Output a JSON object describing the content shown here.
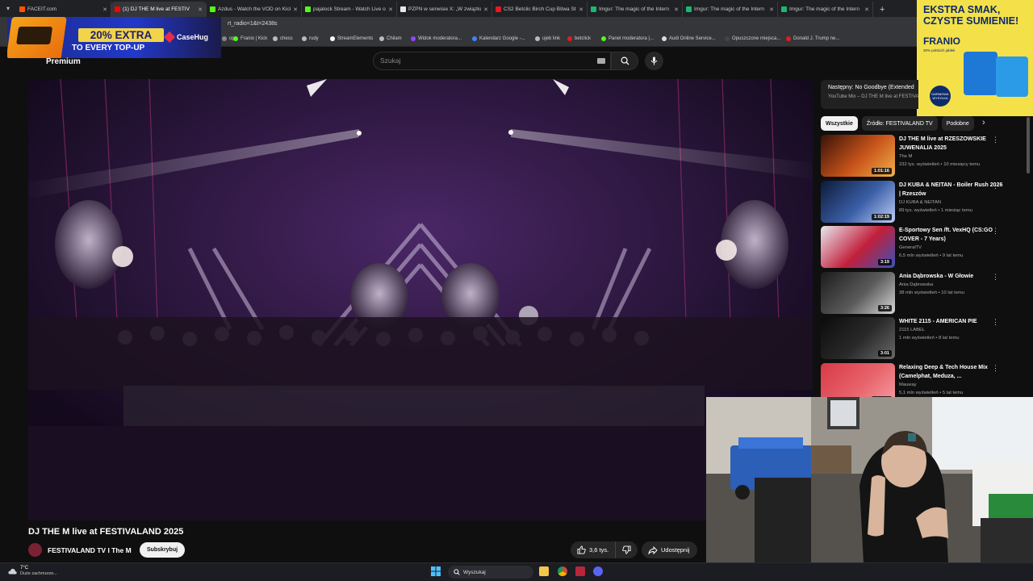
{
  "browser": {
    "tabs": [
      {
        "title": "FACEIT.com",
        "color": "#ff5500",
        "active": false
      },
      {
        "title": "(1) DJ THE M live at FESTIV",
        "color": "#ff0000",
        "active": true
      },
      {
        "title": "Azdus - Watch the VOD on Kick",
        "color": "#53fc18",
        "active": false
      },
      {
        "title": "pajalock Stream - Watch Live o",
        "color": "#53fc18",
        "active": false
      },
      {
        "title": "PZPN w serwisie X: „W związku",
        "color": "#e7e7e7",
        "active": false
      },
      {
        "title": "CS2 Betclic Birch Cup Bitwa Str",
        "color": "#e31b23",
        "active": false
      },
      {
        "title": "Imgur: The magic of the Intern",
        "color": "#1bb76e",
        "active": false
      },
      {
        "title": "Imgur: The magic of the Intern",
        "color": "#1bb76e",
        "active": false
      },
      {
        "title": "Imgur: The magic of the Intern",
        "color": "#1bb76e",
        "active": false
      }
    ],
    "url_fragment": "rt_radio=1&t=2438s",
    "bookmarks": [
      {
        "label": "op",
        "color": "#888888"
      },
      {
        "label": "Franio | Kick",
        "color": "#53fc18"
      },
      {
        "label": "chess",
        "color": "#bbbbbb"
      },
      {
        "label": "rudy",
        "color": "#bbbbbb"
      },
      {
        "label": "StreamElements",
        "color": "#ffffff"
      },
      {
        "label": "Chilam",
        "color": "#bbbbbb"
      },
      {
        "label": "Widok moderatora...",
        "color": "#9146ff"
      },
      {
        "label": "Kalendarz Google -...",
        "color": "#4285f4"
      },
      {
        "label": "ujeb link",
        "color": "#bbbbbb"
      },
      {
        "label": "betclick",
        "color": "#e31b23"
      },
      {
        "label": "Panel moderatora |...",
        "color": "#53fc18"
      },
      {
        "label": "Audi Online Service...",
        "color": "#dddddd"
      },
      {
        "label": "Opuszczone miejsca...",
        "color": "#444444"
      },
      {
        "label": "Donald J. Trump ne...",
        "color": "#e31b23"
      }
    ]
  },
  "ads": {
    "left": {
      "percent": "20% EXTRA",
      "sub": "TO EVERY TOP-UP",
      "brand": "CaseHug"
    },
    "right": {
      "headline1": "EKSTRA SMAK,",
      "headline2": "CZYSTE SUMIENIE!",
      "name": "FRANIO",
      "small": "30% polskich jabłek",
      "badge": "DARMOWA WYSYŁKA"
    }
  },
  "youtube": {
    "logo": "Premium",
    "search_placeholder": "Szukaj",
    "video_title": "DJ THE M live at FESTIVALAND 2025",
    "channel": "FESTIVALAND TV I The M",
    "subscribe": "Subskrybuj",
    "likes": "3,6 tys.",
    "share": "Udostępnij",
    "next_up": {
      "label": "Następny: No Goodbye (Extended",
      "sub": "YouTube Mix – DJ THE M live at FESTIVALAND"
    },
    "chips": [
      "Wszystkie",
      "Źródło: FESTIVALAND TV",
      "Podobne"
    ],
    "recommendations": [
      {
        "title": "DJ THE M live at RZESZOWSKIE JUWENALIA 2025",
        "channel": "The M",
        "meta": "232 tys. wyświetleń • 10 miesięcy temu",
        "duration": "1:01:16",
        "thumb": [
          "#3a1208",
          "#c8541a",
          "#f2b04a"
        ]
      },
      {
        "title": "DJ KUBA & NEITAN - Boiler Rush 2026 | Rzeszów",
        "channel": "DJ KUBA & NEITAN",
        "meta": "89 tys. wyświetleń • 1 miesiąc temu",
        "duration": "1:02:19",
        "thumb": [
          "#0d1a3a",
          "#3b5fa8",
          "#bfd0f5"
        ]
      },
      {
        "title": "E-Sportowy Sen /ft. VexHQ (CS:GO COVER - 7 Years)",
        "channel": "GeneralTV",
        "meta": "6,5 mln wyświetleń • 9 lat temu",
        "duration": "3:19",
        "thumb": [
          "#e8e8f0",
          "#c21f3a",
          "#3a52b8"
        ]
      },
      {
        "title": "Ania Dąbrowska - W Głowie",
        "channel": "Ania Dąbrowska",
        "meta": "38 mln wyświetleń • 10 lat temu",
        "duration": "3:26",
        "thumb": [
          "#1c1c1c",
          "#5a5a5a",
          "#d8d8d8"
        ]
      },
      {
        "title": "WHITE 2115 - AMERICAN PIE",
        "channel": "2115 LABEL",
        "meta": "1 mln wyświetleń • 8 lat temu",
        "duration": "3:01",
        "thumb": [
          "#0b0b0b",
          "#2a2a2a",
          "#6a6a6a"
        ]
      },
      {
        "title": "Relaxing Deep & Tech House Mix (Camelphat, Meduza, ...",
        "channel": "Mauway",
        "meta": "5,1 mln wyświetleń • 5 lat temu",
        "duration": "1:00:00",
        "thumb": [
          "#d83a46",
          "#e8636b",
          "#f4a0a4"
        ]
      }
    ]
  },
  "taskbar": {
    "temp": "7°C",
    "cond": "Duże zachmurze...",
    "search": "Wyszukaj"
  }
}
